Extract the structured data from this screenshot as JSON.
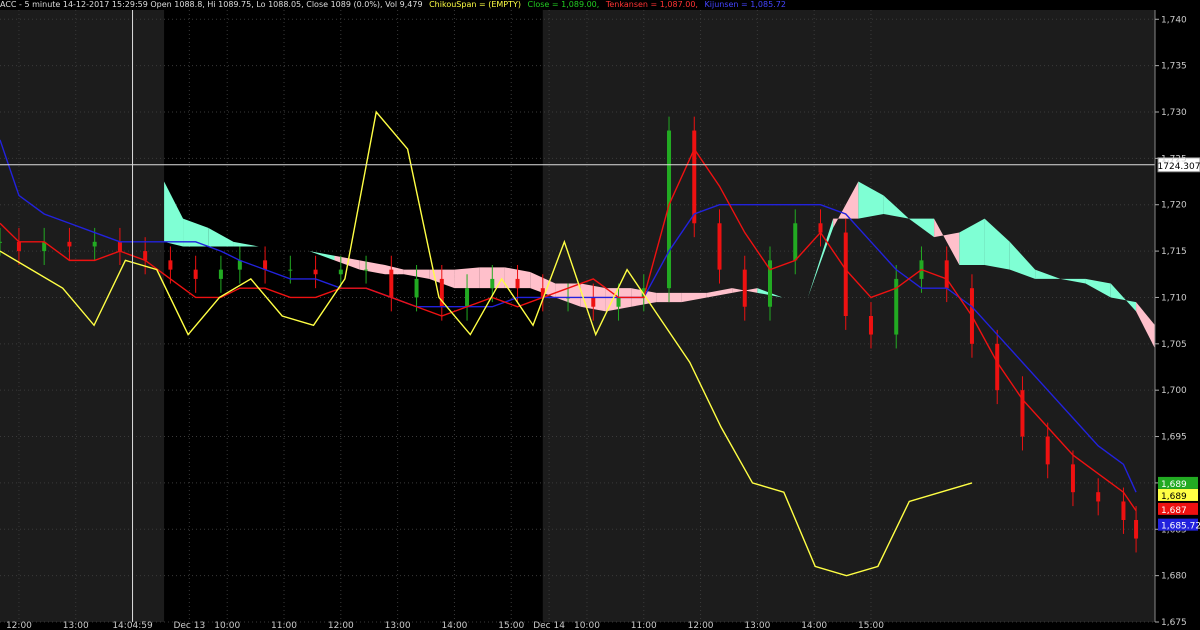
{
  "header": {
    "symbol": "ACC - 5 minute 14-12-2017 15:29:59 Open 1088.8, Hi 1089.75, Lo 1088.05, Close 1089 (0.0%), Vol 9,479",
    "chikou": "ChikouSpan = (EMPTY)",
    "close": "Close = 1,089.00,",
    "tenkan": "Tenkansen = 1,087.00,",
    "kijun": "Kijunsen = 1,085.72"
  },
  "colors": {
    "background": "#000000",
    "session_band": "#1c1c1c",
    "grid": "#3a3a3a",
    "cloud_bear": "#ffc0cb",
    "cloud_bull": "#7fffd4",
    "price_up": "#22aa22",
    "price_down": "#ee1111",
    "tenkan": "#ee1111",
    "kijun": "#2222dd",
    "chikou": "#ffff44",
    "axis_text": "#cccccc"
  },
  "crosshair": {
    "price": 1724.307,
    "label": "1724.307",
    "time_label": "12-12-2017 14:04:59"
  },
  "chart_data": {
    "type": "line",
    "title": "",
    "ylim": [
      1675,
      1741
    ],
    "y_ticks": [
      1675,
      1680,
      1685,
      1690,
      1695,
      1700,
      1705,
      1710,
      1715,
      1720,
      1725,
      1730,
      1735,
      1740
    ],
    "y_tick_labels": [
      "1,675",
      "1,680",
      "1,685",
      "1,690",
      "1,695",
      "1,700",
      "1,705",
      "1,710",
      "1,715",
      "1,720",
      "1,725",
      "1,730",
      "1,735",
      "1,740"
    ],
    "x": [
      0,
      3,
      7,
      11,
      15,
      19,
      23,
      27,
      31,
      35,
      38,
      42,
      46,
      50,
      54,
      58,
      62,
      66,
      70,
      74,
      78,
      82,
      86,
      90,
      94,
      98,
      102,
      106,
      110,
      114,
      118,
      122,
      126,
      130,
      134,
      138,
      142,
      146,
      150,
      154,
      158,
      162,
      166,
      170,
      174,
      178,
      180
    ],
    "x_ticks": [
      {
        "x": 3,
        "label": "12:00"
      },
      {
        "x": 12,
        "label": "13:00"
      },
      {
        "x": 21,
        "label": "14:04:59"
      },
      {
        "x": 30,
        "label": "Dec 13"
      },
      {
        "x": 36,
        "label": "10:00"
      },
      {
        "x": 45,
        "label": "11:00"
      },
      {
        "x": 54,
        "label": "12:00"
      },
      {
        "x": 63,
        "label": "13:00"
      },
      {
        "x": 72,
        "label": "14:00"
      },
      {
        "x": 81,
        "label": "15:00"
      },
      {
        "x": 87,
        "label": "Dec 14"
      },
      {
        "x": 93,
        "label": "10:00"
      },
      {
        "x": 102,
        "label": "11:00"
      },
      {
        "x": 111,
        "label": "12:00"
      },
      {
        "x": 120,
        "label": "13:00"
      },
      {
        "x": 129,
        "label": "14:00"
      },
      {
        "x": 138,
        "label": "15:00"
      }
    ],
    "x_max": 183,
    "sessions": [
      [
        0,
        26
      ],
      [
        26,
        86
      ],
      [
        86,
        183
      ]
    ],
    "series": [
      {
        "name": "Close",
        "values": [
          1716,
          1715,
          1716,
          1715.5,
          1716,
          1715,
          1714,
          1713,
          1712,
          1713,
          1714,
          1713,
          1713,
          1712.5,
          1713,
          1713,
          1710,
          1712,
          1709,
          1711,
          1712,
          1711,
          1710,
          1710,
          1709,
          1710,
          1711,
          1728,
          1718,
          1713,
          1709,
          1714,
          1718,
          1717,
          1708,
          1706,
          1712,
          1714,
          1711,
          1705,
          1700,
          1695,
          1692,
          1689,
          1688,
          1686,
          1684,
          1681,
          1681,
          1683,
          1685,
          1687,
          1689,
          1686,
          1689
        ]
      },
      {
        "name": "Tenkansen",
        "values": [
          1718,
          1716,
          1716,
          1714,
          1714,
          1715,
          1714,
          1712,
          1710,
          1710,
          1711,
          1711,
          1710,
          1710,
          1711,
          1711,
          1710,
          1709,
          1708,
          1709,
          1710,
          1709,
          1710,
          1711,
          1712,
          1710,
          1710,
          1720,
          1726,
          1722,
          1717,
          1713,
          1714,
          1717,
          1713,
          1710,
          1711,
          1713,
          1712,
          1708,
          1703,
          1699,
          1696,
          1693,
          1691,
          1689,
          1687,
          1685,
          1683,
          1682,
          1684,
          1686,
          1687,
          1687,
          1687
        ]
      },
      {
        "name": "Kijunsen",
        "values": [
          1727,
          1721,
          1719,
          1718,
          1717,
          1716,
          1716,
          1716,
          1716,
          1715,
          1714,
          1713,
          1712,
          1712,
          1711,
          1711,
          1710,
          1709,
          1709,
          1709,
          1709,
          1710,
          1710,
          1710,
          1710,
          1710,
          1710,
          1715,
          1719,
          1720,
          1720,
          1720,
          1720,
          1720,
          1719,
          1716,
          1713,
          1711,
          1711,
          1709,
          1706,
          1703,
          1700,
          1697,
          1694,
          1692,
          1689,
          1687,
          1685,
          1684,
          1684,
          1685,
          1686,
          1686,
          1686
        ]
      },
      {
        "name": "ChikouSpan",
        "values": [
          1715,
          1713,
          1711,
          1707,
          1714,
          1713,
          1706,
          1710,
          1712,
          1708,
          1707,
          1712,
          1730,
          1726,
          1710,
          1706,
          1712,
          1707,
          1716,
          1706,
          1713,
          1708,
          1703,
          1696,
          1690,
          1689,
          1681,
          1680,
          1681,
          1688,
          1689,
          1690
        ]
      }
    ],
    "last_values": [
      {
        "name": "Close",
        "label": "1,689"
      },
      {
        "name": "ChikouSpan",
        "label": "1,689"
      },
      {
        "name": "Tenkansen",
        "label": "1,687"
      },
      {
        "name": "Kijunsen",
        "label": "1,685.72"
      }
    ]
  }
}
